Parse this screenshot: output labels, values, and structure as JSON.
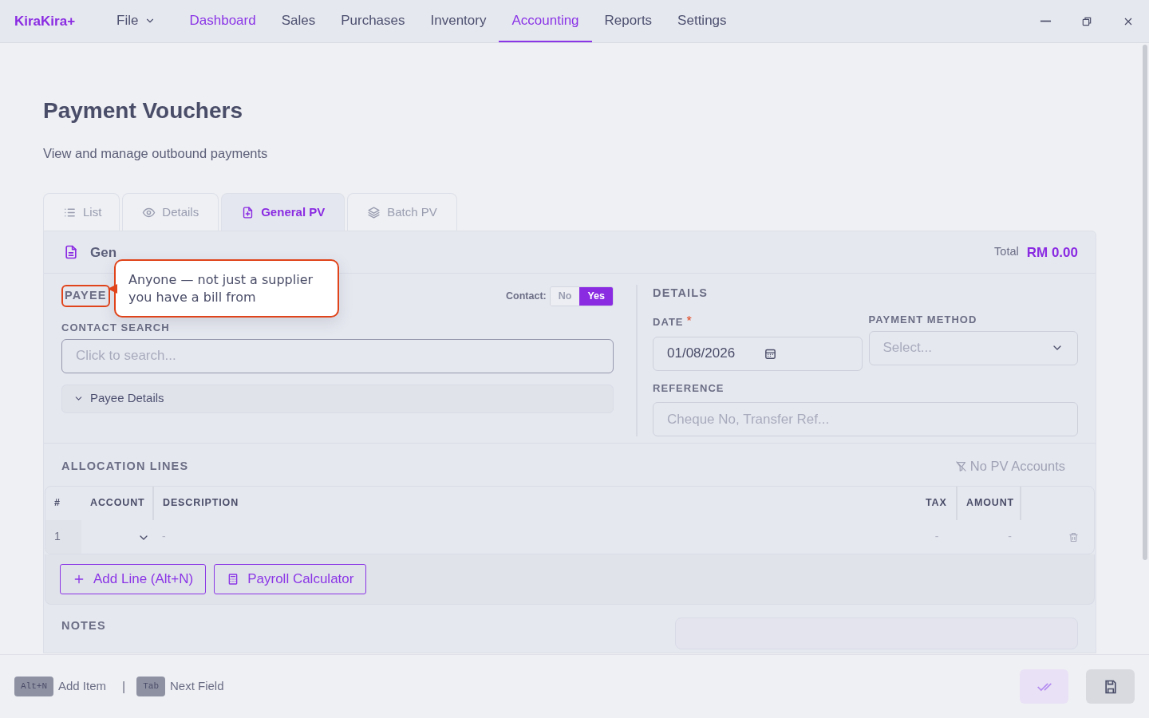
{
  "app": {
    "logo": "KiraKira+"
  },
  "menu": [
    {
      "label": "File",
      "kind": "dropdown",
      "highlighted": false,
      "selected": false
    },
    {
      "label": "Dashboard",
      "kind": "link",
      "highlighted": true,
      "selected": false
    },
    {
      "label": "Sales",
      "kind": "link",
      "highlighted": false,
      "selected": false
    },
    {
      "label": "Purchases",
      "kind": "link",
      "highlighted": false,
      "selected": false
    },
    {
      "label": "Inventory",
      "kind": "link",
      "highlighted": false,
      "selected": false
    },
    {
      "label": "Accounting",
      "kind": "link",
      "highlighted": false,
      "selected": true
    },
    {
      "label": "Reports",
      "kind": "link",
      "highlighted": false,
      "selected": false
    },
    {
      "label": "Settings",
      "kind": "link",
      "highlighted": false,
      "selected": false
    }
  ],
  "page": {
    "title": "Payment Vouchers",
    "subtitle": "View and manage outbound payments"
  },
  "tabs": [
    {
      "label": "List",
      "selected": false
    },
    {
      "label": "Details",
      "selected": false
    },
    {
      "label": "General PV",
      "selected": true
    },
    {
      "label": "Batch PV",
      "selected": false
    }
  ],
  "card": {
    "title": "Gen",
    "total_label": "Total",
    "total": "RM 0.00"
  },
  "tooltip": {
    "text": "Anyone — not just a supplier you have a bill from"
  },
  "payee": {
    "label": "PAYEE",
    "highlighted": true,
    "contact_label": "Contact:",
    "contact_options": [
      {
        "label": "No",
        "selected": false
      },
      {
        "label": "Yes",
        "selected": true
      }
    ],
    "search_label": "CONTACT SEARCH",
    "search_placeholder": "Click to search...",
    "details_toggle": {
      "label": "Payee Details",
      "expanded": false
    }
  },
  "details": {
    "heading": "DETAILS",
    "date_label": "DATE",
    "date_required_marker": "*",
    "date_value": "01/08/2026",
    "method_label": "PAYMENT METHOD",
    "method_placeholder": "Select...",
    "reference_label": "REFERENCE",
    "reference_placeholder": "Cheque No, Transfer Ref..."
  },
  "allocation": {
    "heading": "ALLOCATION LINES",
    "filter_note": "No PV Accounts",
    "columns": [
      "#",
      "ACCOUNT",
      "DESCRIPTION",
      "TAX",
      "AMOUNT"
    ],
    "rows": [
      {
        "number": "1",
        "description": "-",
        "tax": "-",
        "amount": "-"
      }
    ],
    "buttons": [
      "Add Line (Alt+N)",
      "Payroll Calculator"
    ]
  },
  "notes": {
    "heading": "NOTES"
  },
  "footer": {
    "shortcuts": [
      {
        "key": "Alt+N",
        "label": "Add Item"
      },
      {
        "key": "Tab",
        "label": "Next Field"
      }
    ],
    "separator": "|"
  }
}
